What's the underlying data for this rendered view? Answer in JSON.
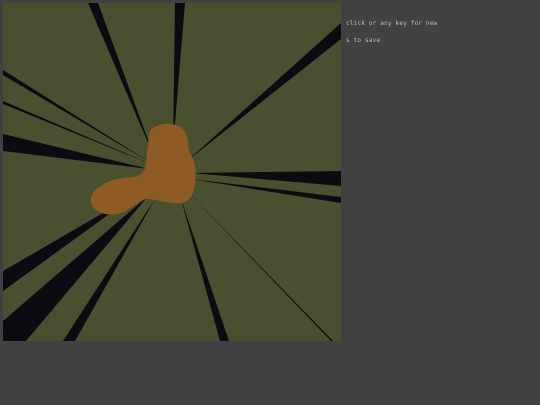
{
  "hints": {
    "new_text": "click or any key for new",
    "save_text": "s to save"
  },
  "colors": {
    "page_background": "#414141",
    "canvas_background": "#4a4f30",
    "ray_color": "#0d0a12",
    "blob_color": "#8d5b23",
    "hint_text": "#bdbdbd"
  }
}
